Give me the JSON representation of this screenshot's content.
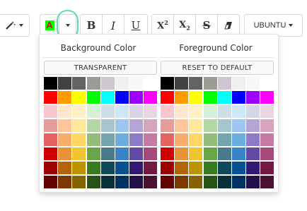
{
  "toolbar": {
    "magic_icon": "magic-wand-icon",
    "color_icon_letter": "A",
    "color_icon_bg": "#00ff00",
    "color_icon_fg": "#e00000",
    "bold": "B",
    "italic": "I",
    "underline": "U",
    "superscript_base": "X",
    "superscript_mark": "2",
    "subscript_base": "X",
    "subscript_mark": "2",
    "strike": "S",
    "eraser_icon": "eraser-icon",
    "font_name": "UBUNTU",
    "focus_color": "#58e0b2"
  },
  "dropdown": {
    "background_title": "Background Color",
    "foreground_title": "Foreground Color",
    "transparent_label": "TRANSPARENT",
    "reset_label": "RESET TO DEFAULT",
    "palette": [
      [
        "#000000",
        "#424242",
        "#636363",
        "#9c9c94",
        "#cec6ce",
        "#efefef",
        "#f7f7f7",
        "#ffffff"
      ],
      [
        "#ff0000",
        "#ff9c00",
        "#ffff00",
        "#00ff00",
        "#00ffff",
        "#0000ff",
        "#9c00ff",
        "#ff00ff"
      ],
      [
        "#f7c6ce",
        "#ffe7ce",
        "#ffefc6",
        "#d6efd6",
        "#cedee7",
        "#cee7f7",
        "#d6d6e7",
        "#e7d6de"
      ],
      [
        "#e79c9c",
        "#ffc69c",
        "#ffe79c",
        "#b5d6a5",
        "#a5c6ce",
        "#9cc6ef",
        "#b5a5d6",
        "#d6a5bd"
      ],
      [
        "#e76363",
        "#f7ad6b",
        "#ffd663",
        "#94bd7b",
        "#73a5ad",
        "#6badde",
        "#8c7bc6",
        "#c67ba5"
      ],
      [
        "#ce0000",
        "#e79439",
        "#efc631",
        "#6ba54a",
        "#4a7b8c",
        "#3984c6",
        "#634aa5",
        "#a54a7b"
      ],
      [
        "#9c0000",
        "#b56308",
        "#bd9400",
        "#397b21",
        "#104a5a",
        "#085294",
        "#311873",
        "#731842"
      ],
      [
        "#630000",
        "#7b3900",
        "#846300",
        "#295218",
        "#083139",
        "#003163",
        "#21104a",
        "#4a1031"
      ]
    ]
  }
}
